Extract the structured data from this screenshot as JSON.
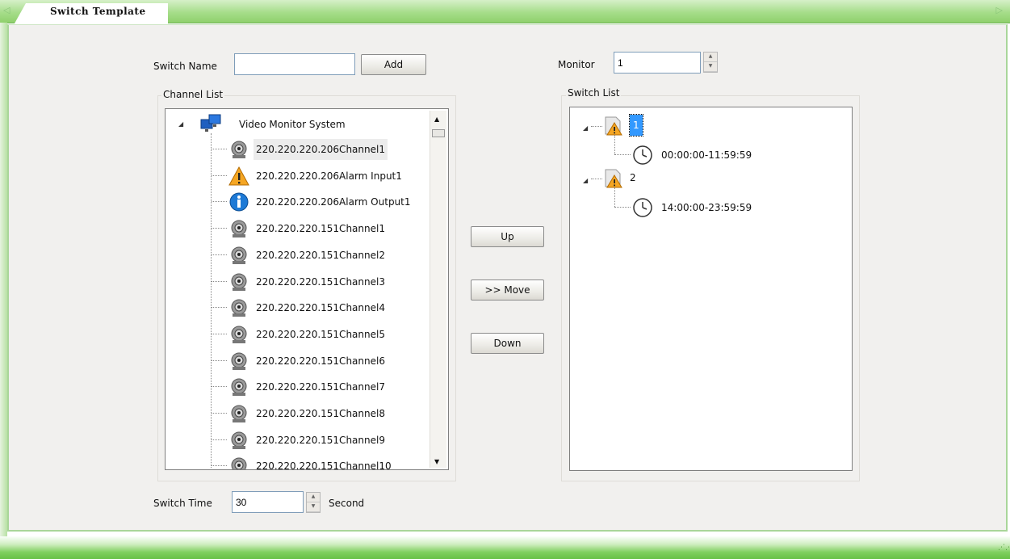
{
  "tab": {
    "title": "Switch Template"
  },
  "form": {
    "switch_name_label": "Switch Name",
    "switch_name_value": "",
    "add_label": "Add",
    "monitor_label": "Monitor",
    "monitor_value": "1",
    "channel_list_label": "Channel List",
    "switch_list_label": "Switch List",
    "switch_time_label": "Switch Time",
    "switch_time_value": "30",
    "second_label": "Second"
  },
  "buttons": {
    "up": "Up",
    "move": ">> Move",
    "down": "Down"
  },
  "channel_tree": {
    "root": "Video Monitor System",
    "items": [
      {
        "label": "220.220.220.206Channel1",
        "icon": "camera-icon",
        "selected": true
      },
      {
        "label": "220.220.220.206Alarm Input1",
        "icon": "warning-icon"
      },
      {
        "label": "220.220.220.206Alarm Output1",
        "icon": "info-icon"
      },
      {
        "label": "220.220.220.151Channel1",
        "icon": "camera-icon"
      },
      {
        "label": "220.220.220.151Channel2",
        "icon": "camera-icon"
      },
      {
        "label": "220.220.220.151Channel3",
        "icon": "camera-icon"
      },
      {
        "label": "220.220.220.151Channel4",
        "icon": "camera-icon"
      },
      {
        "label": "220.220.220.151Channel5",
        "icon": "camera-icon"
      },
      {
        "label": "220.220.220.151Channel6",
        "icon": "camera-icon"
      },
      {
        "label": "220.220.220.151Channel7",
        "icon": "camera-icon"
      },
      {
        "label": "220.220.220.151Channel8",
        "icon": "camera-icon"
      },
      {
        "label": "220.220.220.151Channel9",
        "icon": "camera-icon"
      },
      {
        "label": "220.220.220.151Channel10",
        "icon": "camera-icon"
      }
    ]
  },
  "switch_tree": {
    "nodes": [
      {
        "label": "1",
        "selected": true,
        "child": "00:00:00-11:59:59"
      },
      {
        "label": "2",
        "selected": false,
        "child": "14:00:00-23:59:59"
      }
    ]
  },
  "colors": {
    "accent_green": "#8fd06c",
    "selection_blue": "#3399ff",
    "panel_bg": "#f1f0ee"
  }
}
